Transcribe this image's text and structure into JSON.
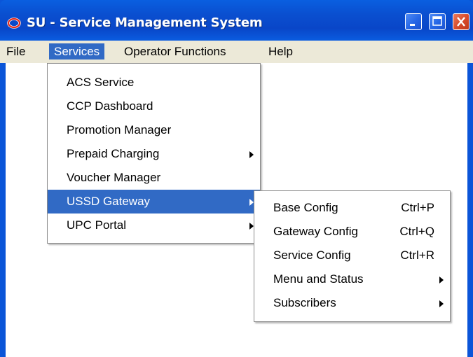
{
  "window": {
    "title": "SU - Service Management System"
  },
  "menubar": {
    "items": [
      {
        "label": "File"
      },
      {
        "label": "Services"
      },
      {
        "label": "Operator Functions"
      },
      {
        "label": "Help"
      }
    ],
    "active": "Services"
  },
  "services_menu": {
    "items": [
      {
        "label": "ACS Service",
        "submenu": false
      },
      {
        "label": "CCP Dashboard",
        "submenu": false
      },
      {
        "label": "Promotion Manager",
        "submenu": false
      },
      {
        "label": "Prepaid Charging",
        "submenu": true
      },
      {
        "label": "Voucher Manager",
        "submenu": false
      },
      {
        "label": "USSD Gateway",
        "submenu": true,
        "highlighted": true
      },
      {
        "label": "UPC Portal",
        "submenu": true
      }
    ]
  },
  "ussd_submenu": {
    "items": [
      {
        "label": "Base Config",
        "accelerator": "Ctrl+P"
      },
      {
        "label": "Gateway Config",
        "accelerator": "Ctrl+Q"
      },
      {
        "label": "Service Config",
        "accelerator": "Ctrl+R"
      },
      {
        "label": "Menu and Status",
        "submenu": true
      },
      {
        "label": "Subscribers",
        "submenu": true
      }
    ]
  },
  "icons": {
    "app": "oracle-logo-icon",
    "minimize": "minimize-icon",
    "maximize": "maximize-icon",
    "close": "close-icon",
    "submenu": "submenu-arrow-icon"
  },
  "colors": {
    "titlebar": "#0a4fd0",
    "menu_highlight": "#316ac5",
    "menubar_bg": "#ece9d8",
    "brand_red": "#e32b1c",
    "close_button": "#d64a2a"
  }
}
